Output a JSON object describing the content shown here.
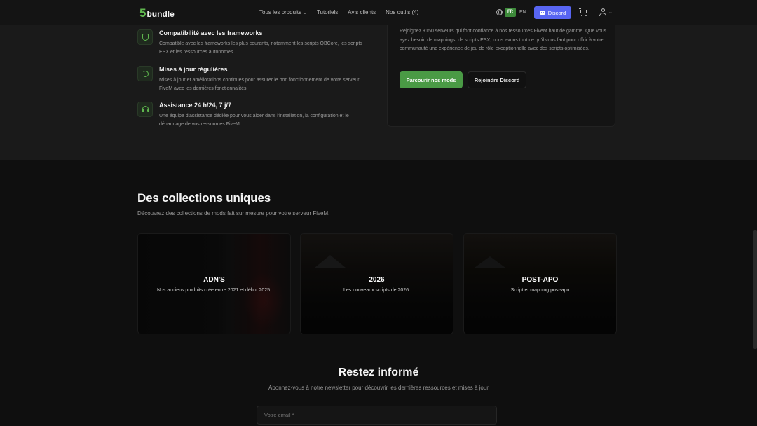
{
  "nav": {
    "logo_number": "5",
    "logo_word": "bundle",
    "links": [
      "Tous les produits",
      "Tutoriels",
      "Avis clients",
      "Nos outils (4)"
    ],
    "lang_active": "FR",
    "lang_other": "EN",
    "discord_label": "Discord"
  },
  "features": [
    {
      "title": "Compatibilité avec les frameworks",
      "desc": "Compatible avec les frameworks les plus courants, notamment les scripts QBCore, les scripts ESX et les ressources autonomes.",
      "icon": "shield-check-icon"
    },
    {
      "title": "Mises à jour régulières",
      "desc": "Mises à jour et améliorations continues pour assurer le bon fonctionnement de votre serveur FiveM avec les dernières fonctionnalités.",
      "icon": "refresh-icon"
    },
    {
      "title": "Assistance 24 h/24, 7 j/7",
      "desc": "Une équipe d'assistance dédiée pour vous aider dans l'installation, la configuration et le dépannage de vos ressources FiveM.",
      "icon": "headset-icon"
    }
  ],
  "cta": {
    "text": "Rejoignez +150 serveurs qui font confiance à nos ressources FiveM haut de gamme. Que vous ayez besoin de mappings, de scripts ESX, nous avons tout ce qu'il vous faut pour offrir à votre communauté une expérience de jeu de rôle exceptionnelle avec des scripts optimisées.",
    "primary_label": "Parcourir nos mods",
    "secondary_label": "Rejoindre Discord"
  },
  "collections": {
    "title": "Des collections uniques",
    "subtitle": "Découvrez des collections de mods fait sur mesure pour votre serveur FiveM.",
    "items": [
      {
        "title": "ADN'S",
        "desc": "Nos anciens produits crée entre 2021 et début 2025."
      },
      {
        "title": "2026",
        "desc": "Les nouveaux scripts de 2026."
      },
      {
        "title": "POST-APO",
        "desc": "Script et mapping post-apo"
      }
    ]
  },
  "newsletter": {
    "title": "Restez informé",
    "subtitle": "Abonnez-vous à notre newsletter pour découvrir les dernières ressources et mises à jour",
    "placeholder": "Votre email *"
  },
  "colors": {
    "accent": "#4a9a45",
    "discord": "#5865f2",
    "background": "#0f0f0f"
  }
}
